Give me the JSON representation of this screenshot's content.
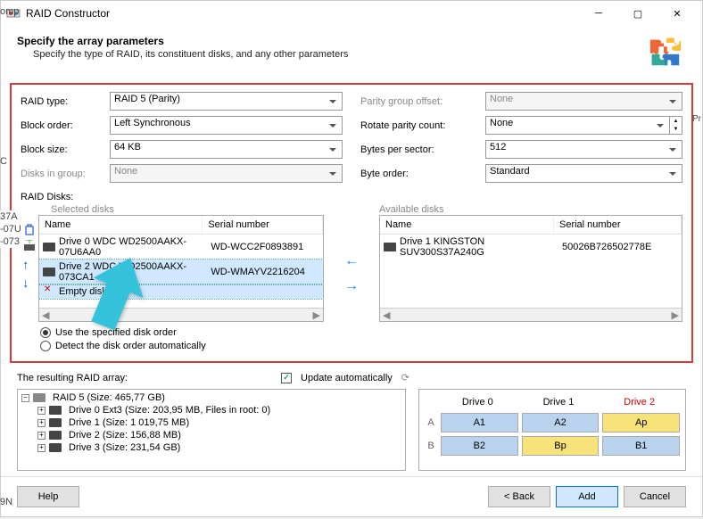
{
  "window": {
    "title": "RAID Constructor"
  },
  "header": {
    "title": "Specify the array parameters",
    "subtitle": "Specify the type of RAID, its constituent disks, and any other parameters"
  },
  "left_form": {
    "raid_type": {
      "label": "RAID type:",
      "value": "RAID 5 (Parity)"
    },
    "block_order": {
      "label": "Block order:",
      "value": "Left Synchronous"
    },
    "block_size": {
      "label": "Block size:",
      "value": "64 KB"
    },
    "disks_in_group": {
      "label": "Disks in group:",
      "value": "None"
    }
  },
  "right_form": {
    "parity_offset": {
      "label": "Parity group offset:",
      "value": "None"
    },
    "rotate_parity": {
      "label": "Rotate parity count:",
      "value": "None"
    },
    "bytes_sector": {
      "label": "Bytes per sector:",
      "value": "512"
    },
    "byte_order": {
      "label": "Byte order:",
      "value": "Standard"
    }
  },
  "disks": {
    "label": "RAID Disks:",
    "selected_label": "Selected disks",
    "available_label": "Available disks",
    "col_name": "Name",
    "col_serial": "Serial number",
    "selected": [
      {
        "name": "Drive 0 WDC WD2500AAKX-07U6AA0",
        "serial": "WD-WCC2F0893891"
      },
      {
        "name": "Drive 2 WDC WD2500AAKX-073CA1",
        "serial": "WD-WMAYV2216204"
      },
      {
        "name": "Empty disk",
        "serial": "",
        "err": true
      }
    ],
    "available": [
      {
        "name": "Drive 1 KINGSTON SUV300S37A240G",
        "serial": "50026B726502778E"
      }
    ]
  },
  "order": {
    "use_specified": "Use the specified disk order",
    "detect_auto": "Detect the disk order automatically"
  },
  "result": {
    "label": "The resulting RAID array:",
    "update_auto": "Update automatically"
  },
  "tree": {
    "root": "RAID 5 (Size: 465,77 GB)",
    "items": [
      "Drive 0 Ext3 (Size: 203,95 MB, Files in root: 0)",
      "Drive 1 (Size: 1 019,75 MB)",
      "Drive 2 (Size: 156,88 MB)",
      "Drive 3 (Size: 231,54 GB)"
    ]
  },
  "grid": {
    "h0": "Drive 0",
    "h1": "Drive 1",
    "h2": "Drive 2",
    "rowA": "A",
    "rowB": "B",
    "A1": "A1",
    "A2": "A2",
    "Ap": "Ap",
    "B2": "B2",
    "Bp": "Bp",
    "B1": "B1"
  },
  "footer": {
    "help": "Help",
    "back": "< Back",
    "add": "Add",
    "cancel": "Cancel"
  },
  "cropped": {
    "l1": "omp",
    "l2": "C",
    "l3": "37A",
    "l4": "-07U",
    "l5": "-073",
    "l6": "9N",
    "l7": "Pr"
  }
}
